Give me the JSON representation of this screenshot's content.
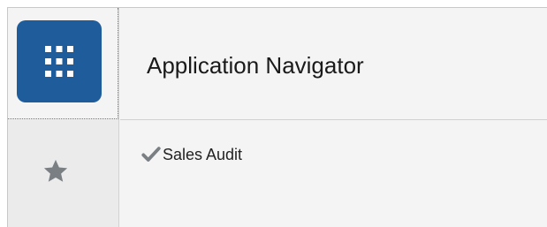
{
  "header": {
    "title": "Application Navigator"
  },
  "rail": {
    "app_icon": "grid-icon",
    "favorites_icon": "star-icon"
  },
  "favorites": {
    "items": [
      {
        "label": "Sales Audit",
        "icon": "check-icon"
      }
    ]
  },
  "colors": {
    "accent": "#1e5c9c",
    "background": "#f4f4f4",
    "rail_background": "#ebebeb",
    "icon_gray": "#7a7f84"
  }
}
